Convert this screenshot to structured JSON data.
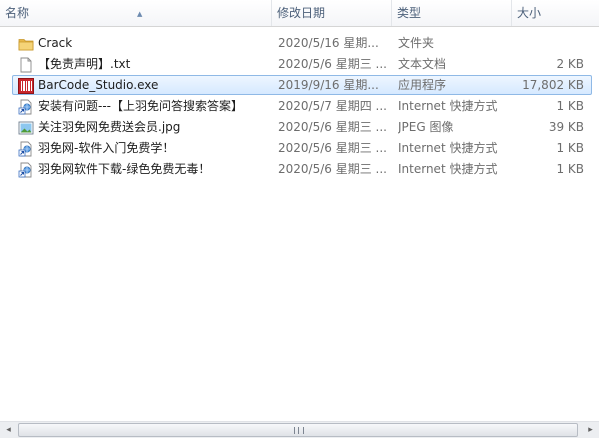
{
  "columns": {
    "name": "名称",
    "date": "修改日期",
    "type": "类型",
    "size": "大小"
  },
  "files": [
    {
      "name": "Crack",
      "date": "2020/5/16 星期...",
      "type": "文件夹",
      "size": "",
      "icon": "folder-icon"
    },
    {
      "name": "【免责声明】.txt",
      "date": "2020/5/6 星期三 ...",
      "type": "文本文档",
      "size": "2 KB",
      "icon": "text-file-icon"
    },
    {
      "name": "BarCode_Studio.exe",
      "date": "2019/9/16 星期...",
      "type": "应用程序",
      "size": "17,802 KB",
      "icon": "barcode-app-icon"
    },
    {
      "name": "安装有问题---【上羽免问答搜索答案】",
      "date": "2020/5/7 星期四 ...",
      "type": "Internet 快捷方式",
      "size": "1 KB",
      "icon": "internet-shortcut-icon"
    },
    {
      "name": "关注羽免网免费送会员.jpg",
      "date": "2020/5/6 星期三 ...",
      "type": "JPEG 图像",
      "size": "39 KB",
      "icon": "image-file-icon"
    },
    {
      "name": "羽免网-软件入门免费学！",
      "date": "2020/5/6 星期三 ...",
      "type": "Internet 快捷方式",
      "size": "1 KB",
      "icon": "internet-shortcut-icon"
    },
    {
      "name": "羽免网软件下载-绿色免费无毒！",
      "date": "2020/5/6 星期三 ...",
      "type": "Internet 快捷方式",
      "size": "1 KB",
      "icon": "internet-shortcut-icon"
    }
  ],
  "selected_index": 2,
  "scrollbar": {
    "left_arrow": "◂",
    "right_arrow": "▸"
  }
}
